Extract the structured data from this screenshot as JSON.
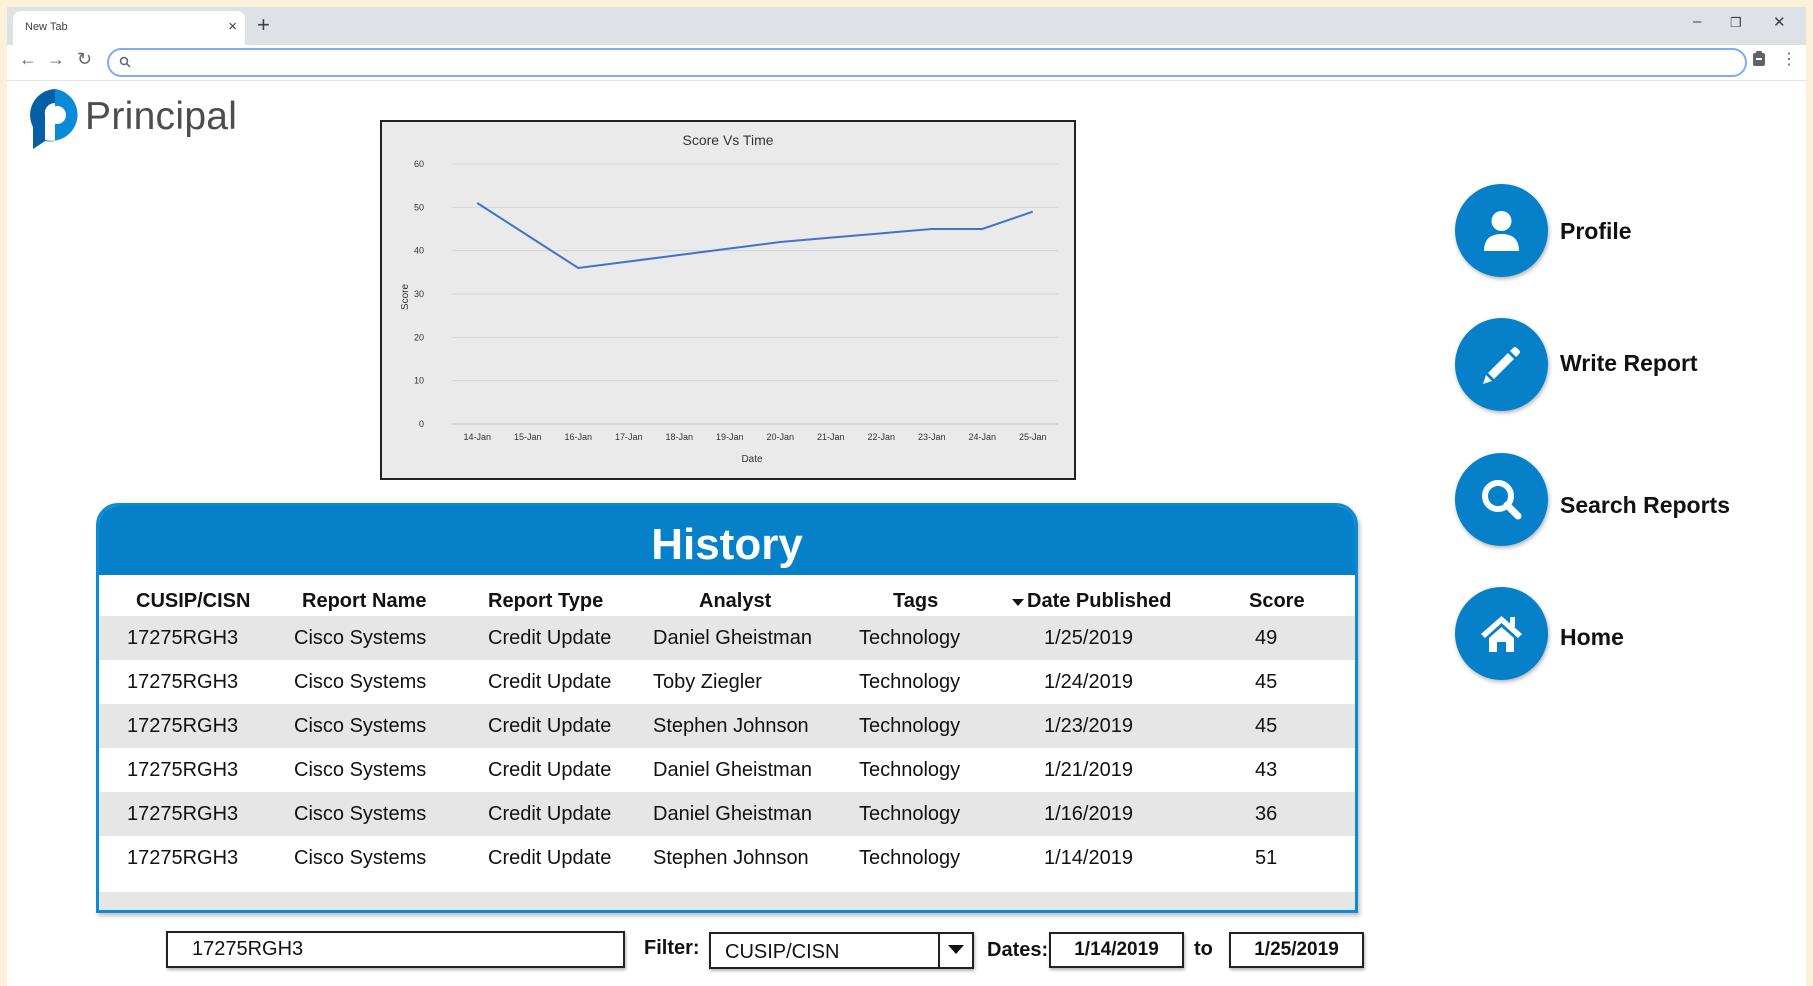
{
  "browser": {
    "tab_title": "New Tab",
    "tab_close": "×",
    "new_tab": "+",
    "url": "",
    "window_minimize": "–",
    "window_restore": "❐",
    "window_close": "✕"
  },
  "logo": {
    "text": "Principal"
  },
  "chart_data": {
    "type": "line",
    "title": "Score Vs Time",
    "xlabel": "Date",
    "ylabel": "Score",
    "categories": [
      "14-Jan",
      "15-Jan",
      "16-Jan",
      "17-Jan",
      "18-Jan",
      "19-Jan",
      "20-Jan",
      "21-Jan",
      "22-Jan",
      "23-Jan",
      "24-Jan",
      "25-Jan"
    ],
    "series": [
      {
        "values": [
          51,
          43.5,
          36,
          37.5,
          39,
          40.5,
          42,
          43,
          44,
          45,
          45,
          49
        ],
        "color": "#4472c4"
      }
    ],
    "ylim": [
      0,
      60
    ],
    "yticks": [
      0,
      10,
      20,
      30,
      40,
      50,
      60
    ],
    "grid": true
  },
  "history": {
    "title": "History",
    "columns": [
      "CUSIP/CISN",
      "Report Name",
      "Report Type",
      "Analyst",
      "Tags",
      "Date Published",
      "Score"
    ],
    "rows": [
      [
        "17275RGH3",
        "Cisco Systems",
        "Credit Update",
        "Daniel Gheistman",
        "Technology",
        "1/25/2019",
        "49"
      ],
      [
        "17275RGH3",
        "Cisco Systems",
        "Credit Update",
        "Toby Ziegler",
        "Technology",
        "1/24/2019",
        "45"
      ],
      [
        "17275RGH3",
        "Cisco Systems",
        "Credit Update",
        "Stephen Johnson",
        "Technology",
        "1/23/2019",
        "45"
      ],
      [
        "17275RGH3",
        "Cisco Systems",
        "Credit Update",
        "Daniel Gheistman",
        "Technology",
        "1/21/2019",
        "43"
      ],
      [
        "17275RGH3",
        "Cisco Systems",
        "Credit Update",
        "Daniel Gheistman",
        "Technology",
        "1/16/2019",
        "36"
      ],
      [
        "17275RGH3",
        "Cisco Systems",
        "Credit Update",
        "Stephen Johnson",
        "Technology",
        "1/14/2019",
        "51"
      ]
    ],
    "sort_column": "Date Published",
    "sort_direction": "descending"
  },
  "nav": {
    "profile": "Profile",
    "write_report": "Write Report",
    "search_reports": "Search Reports",
    "home": "Home"
  },
  "filters": {
    "search_value": "17275RGH3",
    "filter_label": "Filter:",
    "filter_value": "CUSIP/CISN",
    "dates_label": "Dates:",
    "date_from": "1/14/2019",
    "to_label": "to",
    "date_to": "1/25/2019"
  },
  "colors": {
    "brand_blue": "#0580c9",
    "chart_line": "#4472c4"
  }
}
